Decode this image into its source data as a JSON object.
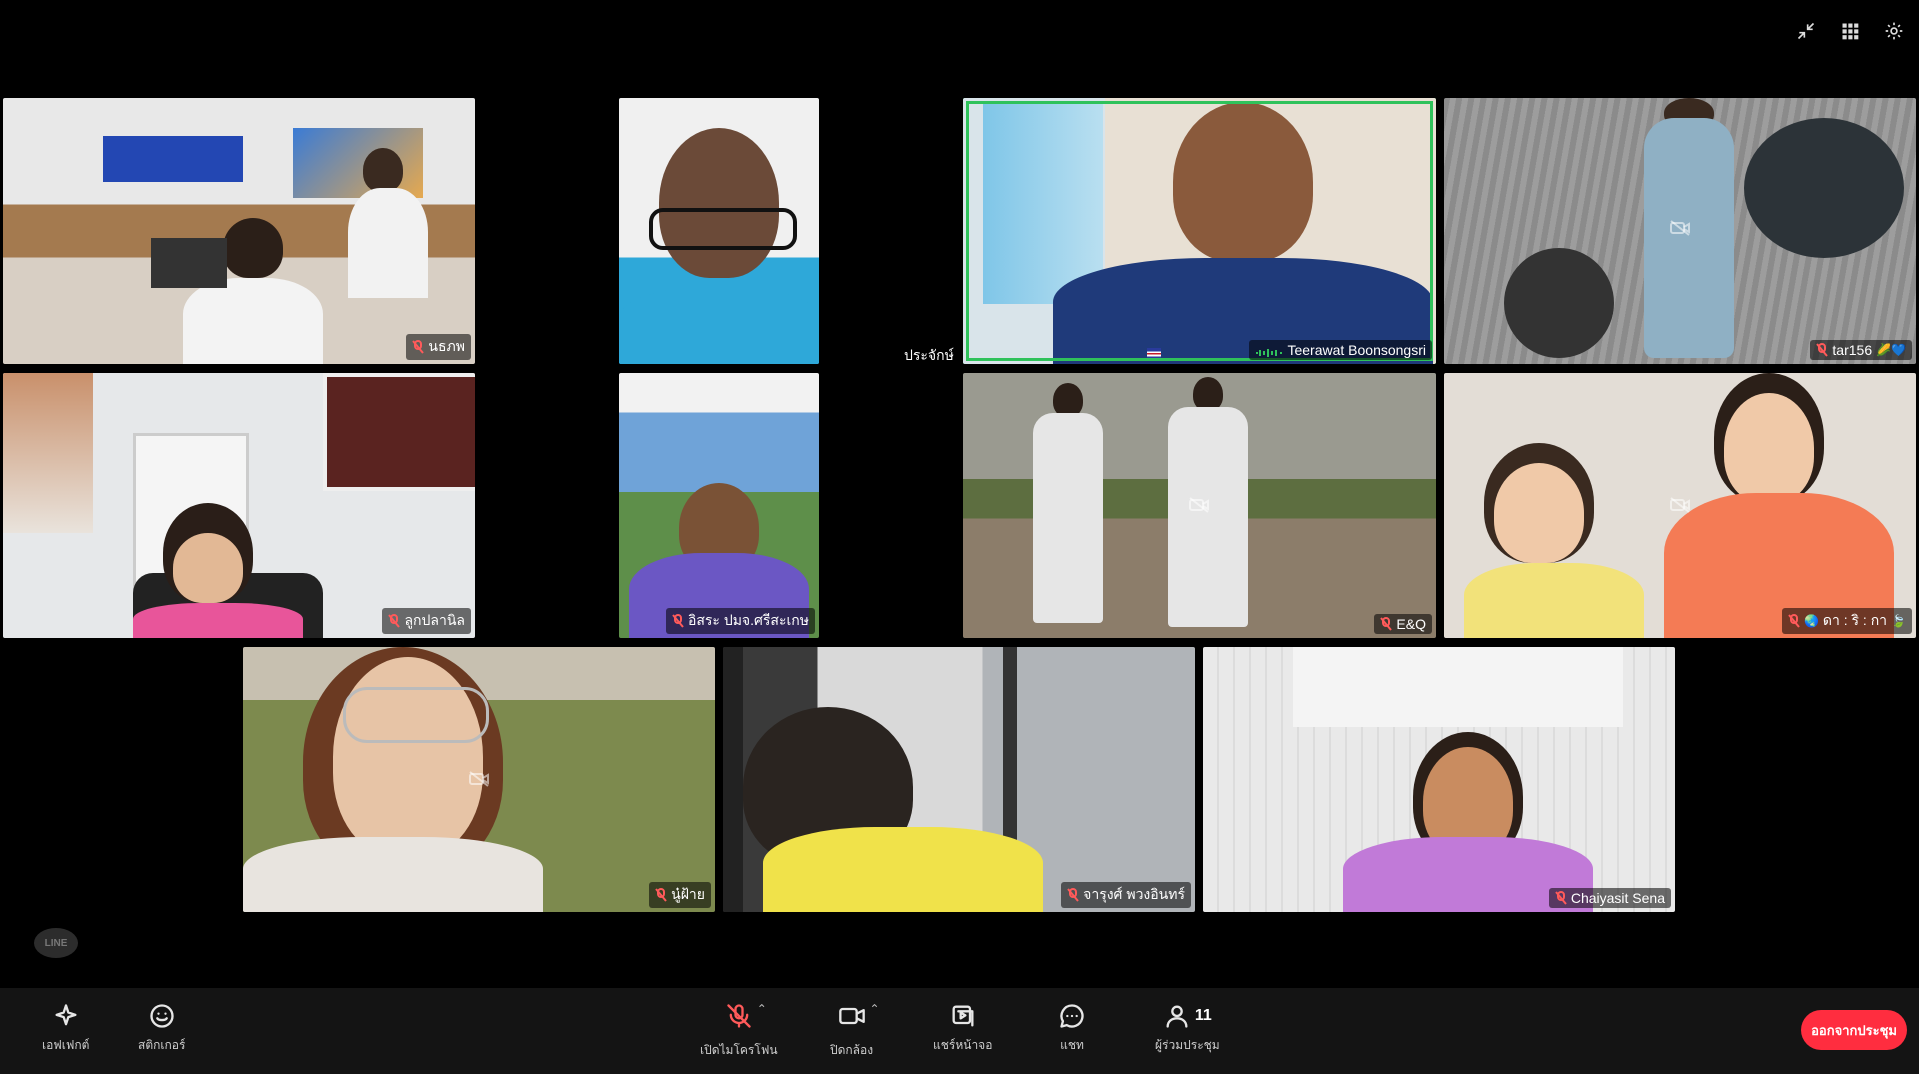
{
  "participants": [
    {
      "name": "นธภพ",
      "status": ""
    },
    {
      "name": "",
      "status": ""
    },
    {
      "name": "Teerawat Boonsongsri",
      "status": "speaking"
    },
    {
      "name": "tar156",
      "status": ""
    },
    {
      "name": "ลูกปลานิล",
      "status": ""
    },
    {
      "name": "อิสระ ปมจ.ศรีสะเกษ",
      "status": ""
    },
    {
      "name": "E&Q",
      "status": ""
    },
    {
      "name": "ดา : ริ : กา",
      "status": ""
    },
    {
      "name": "นู๋ฝ้าย",
      "status": ""
    },
    {
      "name": "จารุงศ์ พวงอินทร์",
      "status": ""
    },
    {
      "name": "Chaiyasit Sena",
      "status": ""
    }
  ],
  "floating_name": "ประจักษ์",
  "line_logo": "LINE",
  "toolbar": {
    "effects": "เอฟเฟกต์",
    "stickers": "สติกเกอร์",
    "mic": "เปิดไมโครโฟน",
    "camera": "ปิดกล้อง",
    "share": "แชร์หน้าจอ",
    "chat": "แชท",
    "participants": "ผู้ร่วมประชุม",
    "participant_count": "11",
    "leave": "ออกจากประชุม"
  },
  "colors": {
    "speaking": "#2fc25b",
    "leave": "#ff2d3f",
    "mic_off": "#ff5a5a"
  }
}
